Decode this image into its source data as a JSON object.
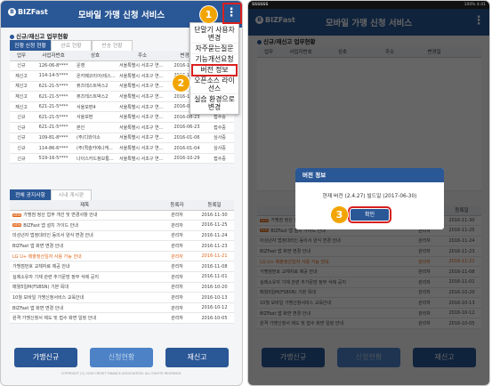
{
  "app": {
    "logo_text": "BIZFast",
    "title": "모바일 가맹 신청 서비스"
  },
  "section_title": "신규/재신고 업무현황",
  "status_tabs": [
    "진행 신청 현황",
    "완료 현황",
    "반송 현황"
  ],
  "status_columns": [
    "업무",
    "사업자번호",
    "상호",
    "주소",
    "변경일"
  ],
  "status_rows": [
    [
      "신규",
      "126-06-8****",
      "운영",
      "서울특별시 서초구 연...",
      "2016-12-01"
    ],
    [
      "재신고",
      "114-14-5****",
      "온카페코리아(테스...",
      "서울특별시 서초구 연...",
      "2016-11-18"
    ],
    [
      "재신고",
      "621-21-5****",
      "퓨즈테스트박스2",
      "서울특별시 서초구 연...",
      "2016-11-18"
    ],
    [
      "재신고",
      "621-21-5****",
      "퓨즈테스트박스2",
      "서울특별시 서초구 연...",
      "2016-11-21"
    ],
    [
      "재신고",
      "621-21-5****",
      "서울보편4",
      "서울특별시 서초구 연...",
      "2016-08-31"
    ],
    [
      "신규",
      "621-21-5****",
      "서울보편",
      "서울특별시 서초구 연...",
      "2016-08-23"
    ],
    [
      "신규",
      "621-21-5****",
      "본인",
      "서울특별시 서초구 연...",
      "2016-06-23"
    ],
    [
      "신규",
      "109-81-8****",
      "(주)디와이소",
      "서울특별시 서초구 연...",
      "2016-01-06"
    ],
    [
      "신규",
      "114-86-6****",
      "(주)퀵슬카에니캐...",
      "서울특별시 서초구 연...",
      "2016-01-04"
    ],
    [
      "신규",
      "519-16-5****",
      "나이스카드정보통...",
      "서울특별시 서초구 연...",
      "2016-10-29"
    ]
  ],
  "status_extra_col": [
    "접수중",
    "접수중",
    "접수중",
    "접수중",
    "접수중",
    "접수중",
    "접수중",
    "심사중",
    "심사중",
    "접수중"
  ],
  "notice_tabs": [
    "전체 공지사항",
    "시내 게시판"
  ],
  "notice_columns": [
    "제목",
    "등록자",
    "등록일"
  ],
  "notices": [
    {
      "title": "가맹점 정산 업무 개선 및 변경사항 안내",
      "author": "관리자",
      "date": "2016-11-30",
      "badge": "NEW",
      "highlight": false
    },
    {
      "title": "BIZFast 앱 설치 가이드 안내",
      "author": "관리자",
      "date": "2016-11-25",
      "badge": "NEW",
      "highlight": false
    },
    {
      "title": "미성년자 법정대리인 동의서 양식 변경 안내",
      "author": "관리자",
      "date": "2016-11-24",
      "badge": "",
      "highlight": false
    },
    {
      "title": "BIZFast 앱 화면 변경 안내",
      "author": "관리자",
      "date": "2016-11-23",
      "badge": "",
      "highlight": false
    },
    {
      "title": "LG U+ 매출정산일자 사용 가능 안내",
      "author": "관리자",
      "date": "2016-11-21",
      "badge": "",
      "highlight": true
    },
    {
      "title": "가맹점번호 교체자료 제공 안내",
      "author": "관리자",
      "date": "2016-11-08",
      "badge": "",
      "highlight": false
    },
    {
      "title": "실제소유자 기재 관련 추가문방 정부 삭제 공지",
      "author": "관리자",
      "date": "2016-11-01",
      "badge": "",
      "highlight": false
    },
    {
      "title": "매월5일M(FSBSN) 기본 목대",
      "author": "관리자",
      "date": "2016-10-20",
      "badge": "",
      "highlight": false
    },
    {
      "title": "10월 모바일 가맹신청서비스 교육안내",
      "author": "관리자",
      "date": "2016-10-13",
      "badge": "",
      "highlight": false
    },
    {
      "title": "BIZFast 앱 화면 변경 안내",
      "author": "관리자",
      "date": "2016-10-12",
      "badge": "",
      "highlight": false
    },
    {
      "title": "원격 가맹신청서 제도 및 접수 화면 일정 안내",
      "author": "관리자",
      "date": "2016-10-05",
      "badge": "",
      "highlight": false
    }
  ],
  "bottom_buttons": [
    "가맹신규",
    "신청현황",
    "재신고"
  ],
  "copyright": "COPYRIGHT (C) 2016 CREDIT FINANCE ASSOCIATION. ALL RIGHTS RESERVED.",
  "menu_items": [
    "단말기 사용자 변경",
    "자주묻는질문",
    "기능개선요청",
    "버전 정보",
    "오픈소스 라이선스",
    "실습 환경으로 변경"
  ],
  "steps": [
    "1",
    "2",
    "3"
  ],
  "statusbar": {
    "left": "SSSSSS",
    "right": "100% 4:41"
  },
  "dialog": {
    "title": "버전 정보",
    "message": "현재 버전 (2.4.27) 빌드일 (2017-06-30)",
    "ok": "확인"
  },
  "colors": {
    "header": "#2a5796",
    "accent": "#f2a500",
    "highlight": "#d9201f",
    "notice_highlight": "#e0661a"
  }
}
